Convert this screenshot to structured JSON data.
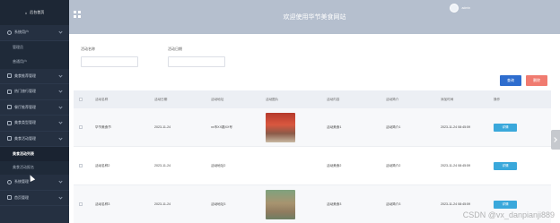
{
  "sidebar": {
    "home": "后台首页",
    "items": [
      {
        "label": "系统用户",
        "icon": "user-icon",
        "expanded": true
      },
      {
        "label": "管理员",
        "sub": true
      },
      {
        "label": "普通用户",
        "sub": true
      },
      {
        "label": "美食推荐管理",
        "icon": "list-icon"
      },
      {
        "label": "热门旅行管理",
        "icon": "list-icon"
      },
      {
        "label": "餐厅推荐管理",
        "icon": "list-icon"
      },
      {
        "label": "美食类型管理",
        "icon": "list-icon"
      },
      {
        "label": "美食活动管理",
        "icon": "list-icon",
        "expanded": true
      },
      {
        "label": "美食活动列表",
        "sub": true,
        "active": true
      },
      {
        "label": "美食活动报名",
        "sub": true
      },
      {
        "label": "系统管理",
        "icon": "settings-icon"
      },
      {
        "label": "首页管理",
        "icon": "list-icon"
      }
    ]
  },
  "header": {
    "title": "欢迎使用华节美食网站",
    "user": "admin"
  },
  "search": {
    "name_label": "活动名称",
    "date_label": "活动日期",
    "name_value": "",
    "date_value": ""
  },
  "buttons": {
    "search": "查询",
    "delete": "删除"
  },
  "table": {
    "headers": [
      "活动名称",
      "活动日期",
      "活动地址",
      "活动图片",
      "活动内容",
      "活动简介",
      "添加时间",
      "操作"
    ],
    "rows": [
      {
        "name": "华节美食节",
        "date": "2023-11-24",
        "address": "xx市XX路XX号",
        "image": "red",
        "content": "活动美食1",
        "intro": "活动简介1",
        "time": "2023-11-24 08:45:59",
        "action": "详情"
      },
      {
        "name": "活动名称2",
        "date": "2023-11-24",
        "address": "活动地址2",
        "image": "none",
        "content": "活动美食2",
        "intro": "活动简介2",
        "time": "2023-11-24 08:45:59",
        "action": "详情"
      },
      {
        "name": "活动名称3",
        "date": "2023-11-24",
        "address": "活动地址3",
        "image": "green",
        "content": "活动美食3",
        "intro": "活动简介3",
        "time": "2023-11-24 08:45:59",
        "action": "详情"
      }
    ]
  },
  "watermark": "CSDN @vx_danpianji889",
  "colors": {
    "sidebar": "#253041",
    "topbar": "#b5bfce",
    "primary": "#2e6dce",
    "danger": "#f07b70",
    "info": "#3aa8db"
  }
}
